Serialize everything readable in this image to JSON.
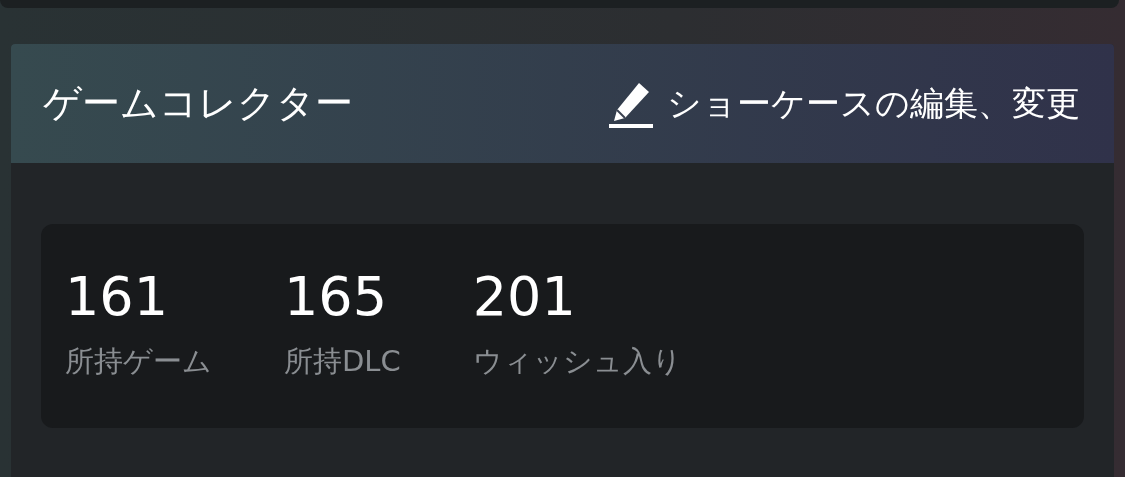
{
  "header": {
    "title": "ゲームコレクター",
    "edit_link": "ショーケースの編集、変更"
  },
  "stats": [
    {
      "value": "161",
      "label": "所持ゲーム"
    },
    {
      "value": "165",
      "label": "所持DLC"
    },
    {
      "value": "201",
      "label": "ウィッシュ入り"
    }
  ]
}
